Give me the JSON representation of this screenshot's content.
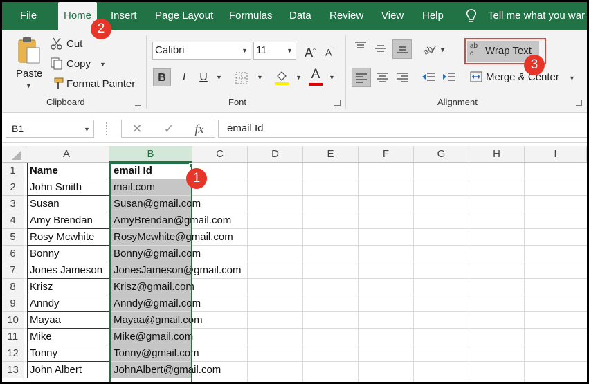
{
  "tabs": [
    "File",
    "Home",
    "Insert",
    "Page Layout",
    "Formulas",
    "Data",
    "Review",
    "View",
    "Help"
  ],
  "tell_me": "Tell me what you war",
  "clipboard": {
    "paste_label": "Paste",
    "cut_label": "Cut",
    "copy_label": "Copy",
    "format_painter_label": "Format Painter",
    "group_label": "Clipboard"
  },
  "font": {
    "font_name": "Calibri",
    "font_size": "11",
    "bold": "B",
    "italic": "I",
    "underline": "U",
    "font_color_glyph": "A",
    "group_label": "Font"
  },
  "alignment": {
    "wrap_text_label": "Wrap Text",
    "merge_center_label": "Merge & Center",
    "group_label": "Alignment",
    "wrap_icon_glyph": "ab c"
  },
  "formula_bar": {
    "name_box": "B1",
    "fx": "fx",
    "formula": "email Id"
  },
  "columns": [
    "A",
    "B",
    "C",
    "D",
    "E",
    "F",
    "G",
    "H",
    "I"
  ],
  "rows": [
    {
      "num": "1",
      "a": "Name",
      "b": "email Id"
    },
    {
      "num": "2",
      "a": "John Smith",
      "b": "mail.com"
    },
    {
      "num": "3",
      "a": "Susan",
      "b": "Susan@gmail.com"
    },
    {
      "num": "4",
      "a": "Amy Brendan",
      "b": "AmyBrendan@gmail.com"
    },
    {
      "num": "5",
      "a": "Rosy Mcwhite",
      "b": "RosyMcwhite@gmail.com"
    },
    {
      "num": "6",
      "a": "Bonny",
      "b": "Bonny@gmail.com"
    },
    {
      "num": "7",
      "a": "Jones Jameson",
      "b": "JonesJameson@gmail.com"
    },
    {
      "num": "8",
      "a": "Krisz",
      "b": "Krisz@gmail.com"
    },
    {
      "num": "9",
      "a": "Anndy",
      "b": "Anndy@gmail.com"
    },
    {
      "num": "10",
      "a": "Mayaa",
      "b": "Mayaa@gmail.com"
    },
    {
      "num": "11",
      "a": "Mike",
      "b": "Mike@gmail.com"
    },
    {
      "num": "12",
      "a": "Tonny",
      "b": "Tonny@gmail.com"
    },
    {
      "num": "13",
      "a": "John Albert",
      "b": "JohnAlbert@gmail.com"
    }
  ],
  "badges": [
    "1",
    "2",
    "3"
  ],
  "colors": {
    "excel_green": "#217346",
    "selection_fill": "#c6c6c6",
    "badge_red": "#e8352a",
    "highlight_box": "#e0443a"
  }
}
